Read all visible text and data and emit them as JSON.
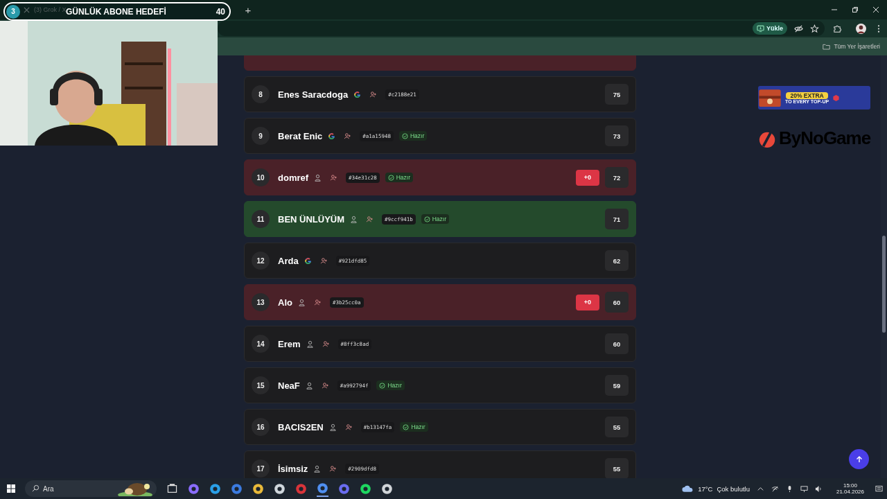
{
  "browser": {
    "tabs": [
      {
        "title": "(3) Grok / X",
        "selected": false
      }
    ],
    "new_tab": "+",
    "install_button": "Yükle",
    "bookmarks_label": "Tüm Yer İşaretleri"
  },
  "stream_overlay": {
    "rank": "3",
    "label": "GÜNLÜK ABONE HEDEFİ",
    "count": "40"
  },
  "leaderboard": {
    "clipped_row": {
      "color": "#4a2128"
    },
    "rows": [
      {
        "rank": "8",
        "name": "Enes Saracdoga",
        "kind": "google",
        "code": "#c2188e21",
        "score": "75"
      },
      {
        "rank": "9",
        "name": "Berat Enic",
        "kind": "google",
        "code": "#a1a15948",
        "status": "Hazır",
        "score": "73"
      },
      {
        "rank": "10",
        "name": "domref",
        "kind": "guest",
        "code": "#34e31c28",
        "status": "Hazır",
        "bonus": "+0",
        "score": "72",
        "color": "#4a2128"
      },
      {
        "rank": "11",
        "name": "BEN ÜNLÜYÜM",
        "kind": "guest",
        "code": "#9ccf941b",
        "status": "Hazır",
        "score": "71",
        "color": "#244a2c"
      },
      {
        "rank": "12",
        "name": "Arda",
        "kind": "google",
        "code": "#921dfd85",
        "score": "62"
      },
      {
        "rank": "13",
        "name": "Alo",
        "kind": "guest",
        "code": "#3b25cc0a",
        "bonus": "+0",
        "score": "60",
        "color": "#4a2128"
      },
      {
        "rank": "14",
        "name": "Erem",
        "kind": "guest",
        "code": "#8ff3c8ad",
        "score": "60"
      },
      {
        "rank": "15",
        "name": "NeaF",
        "kind": "guest",
        "code": "#a992794f",
        "status": "Hazır",
        "score": "59"
      },
      {
        "rank": "16",
        "name": "BACIS2EN",
        "kind": "guest",
        "code": "#b13147fa",
        "status": "Hazır",
        "score": "55"
      },
      {
        "rank": "17",
        "name": "İsimsiz",
        "kind": "guest",
        "code": "#2909dfd8",
        "score": "55"
      }
    ]
  },
  "ads": {
    "banner_headline": "20% EXTRA",
    "banner_subline": "TO EVERY TOP-UP",
    "logo_text": "ByNoGame"
  },
  "taskbar": {
    "search_placeholder": "Ara",
    "temperature": "17°C",
    "weather_text": "Çok bulutlu",
    "time": "15:00",
    "date": "21.04.2026"
  }
}
